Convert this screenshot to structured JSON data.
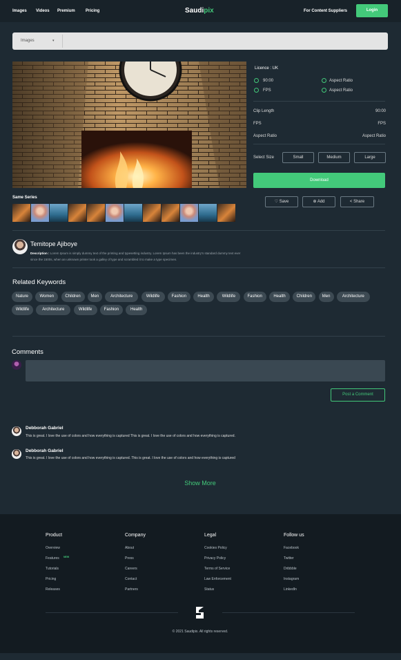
{
  "header": {
    "nav": [
      "Images",
      "Videos",
      "Premium",
      "Pricing"
    ],
    "logo_main": "Saudi",
    "logo_accent": "pix",
    "suppliers_link": "For Content Suppliers",
    "login_label": "Login"
  },
  "search": {
    "type_label": "Images",
    "caret": "▾"
  },
  "details": {
    "licence": "Licence : UK",
    "options": [
      "90:00",
      "Aspect Ratio",
      "FPS",
      "Aspect Ratio"
    ],
    "specs": [
      {
        "label": "Clip Length",
        "value": "90:00"
      },
      {
        "label": "FPS",
        "value": "FPS"
      },
      {
        "label": "Aspect Ratio",
        "value": "Aspect Ratio"
      }
    ],
    "select_size_label": "Select Size",
    "sizes": [
      "Small",
      "Medium",
      "Large"
    ],
    "download_label": "Download",
    "actions": [
      {
        "label": "Save",
        "icon": "heart-icon"
      },
      {
        "label": "Add",
        "icon": "plus-circle-icon"
      },
      {
        "label": "Share",
        "icon": "share-icon"
      }
    ]
  },
  "same_series": {
    "title": "Same Series",
    "thumbs": [
      "fire",
      "girl",
      "sea",
      "fire",
      "fire",
      "girl",
      "sea",
      "fire",
      "fire",
      "girl",
      "sea",
      "fire"
    ]
  },
  "author": {
    "name": "Temitope Ajiboye",
    "desc_label": "Description :",
    "desc_text": "Lorem Ipsum is simply dummy text of the printing and typesetting industry. Lorem Ipsum has been the industry's standard dummy text ever since the 1500s, when an unknown printer took a galley of type and scrambled it to make a type specimen."
  },
  "keywords": {
    "title": "Related Keywords",
    "row1": [
      "Nature",
      "Women",
      "Children",
      "Men",
      "Architecture",
      "Wildlife",
      "Fashion",
      "Health",
      "Wildlife",
      "Fashion",
      "Health",
      "Children",
      "Men",
      "Architecture"
    ],
    "row2": [
      "Wildlife",
      "Architecture",
      "Wildlife",
      "Fashion",
      "Health"
    ]
  },
  "comments": {
    "title": "Comments",
    "post_label": "Post a Comment",
    "items": [
      {
        "name": "Debborah Gabriel",
        "text": "This is great. I love the use of colors and how everything is captured This is great. I love the use of colors and how everything is captured."
      },
      {
        "name": "Debborah Gabriel",
        "text": "This is great. I love the use of colors and how everything is captured. This is great. I love the use of colors and how everything is captured"
      }
    ],
    "show_more": "Show More"
  },
  "footer": {
    "columns": [
      {
        "title": "Product",
        "links": [
          "Overview",
          "Features",
          "Tutorials",
          "Pricing",
          "Releases"
        ]
      },
      {
        "title": "Company",
        "links": [
          "About",
          "Press",
          "Careers",
          "Contact",
          "Partners"
        ]
      },
      {
        "title": "Legal",
        "links": [
          "Cookies Policy",
          "Privacy Policy",
          "Terms of Service",
          "Law Enforcement",
          "Status"
        ]
      },
      {
        "title": "Follow us",
        "links": [
          "Facebook",
          "Twitter",
          "Dribbble",
          "Instagram",
          "LinkedIn"
        ]
      }
    ],
    "beta_badge": "NEW",
    "copyright": "© 2021 Saudipix. All rights reserved."
  },
  "colors": {
    "accent": "#43c97a",
    "background": "#1e2a33",
    "footer": "#131b21"
  }
}
